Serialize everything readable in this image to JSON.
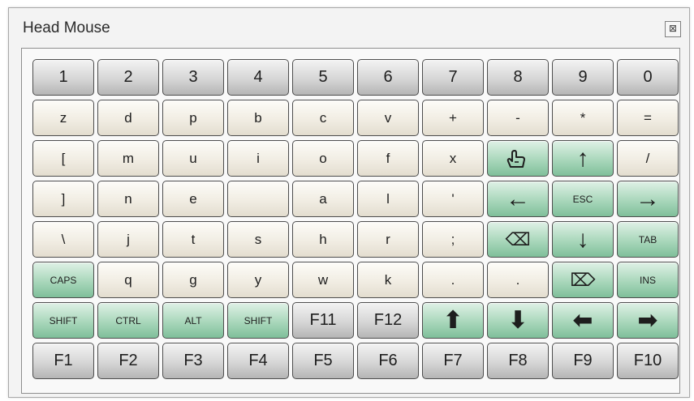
{
  "window": {
    "title": "Head Mouse",
    "close_glyph": "⊠"
  },
  "keyboard": {
    "rows": [
      [
        {
          "label": "1",
          "style": "gray"
        },
        {
          "label": "2",
          "style": "gray"
        },
        {
          "label": "3",
          "style": "gray"
        },
        {
          "label": "4",
          "style": "gray"
        },
        {
          "label": "5",
          "style": "gray"
        },
        {
          "label": "6",
          "style": "gray"
        },
        {
          "label": "7",
          "style": "gray"
        },
        {
          "label": "8",
          "style": "gray"
        },
        {
          "label": "9",
          "style": "gray"
        },
        {
          "label": "0",
          "style": "gray"
        }
      ],
      [
        {
          "label": "z",
          "style": "cream"
        },
        {
          "label": "d",
          "style": "cream"
        },
        {
          "label": "p",
          "style": "cream"
        },
        {
          "label": "b",
          "style": "cream"
        },
        {
          "label": "c",
          "style": "cream"
        },
        {
          "label": "v",
          "style": "cream"
        },
        {
          "label": "+",
          "style": "cream"
        },
        {
          "label": "-",
          "style": "cream"
        },
        {
          "label": "*",
          "style": "cream"
        },
        {
          "label": "=",
          "style": "cream"
        }
      ],
      [
        {
          "label": "[",
          "style": "cream"
        },
        {
          "label": "m",
          "style": "cream"
        },
        {
          "label": "u",
          "style": "cream"
        },
        {
          "label": "i",
          "style": "cream"
        },
        {
          "label": "o",
          "style": "cream"
        },
        {
          "label": "f",
          "style": "cream"
        },
        {
          "label": "x",
          "style": "cream"
        },
        {
          "label": "",
          "style": "green",
          "icon": "hand-pointer-icon"
        },
        {
          "label": "↑",
          "style": "green",
          "icon": "arrow-up-icon"
        },
        {
          "label": "/",
          "style": "cream"
        }
      ],
      [
        {
          "label": "]",
          "style": "cream"
        },
        {
          "label": "n",
          "style": "cream"
        },
        {
          "label": "e",
          "style": "cream"
        },
        {
          "label": "",
          "style": "cream"
        },
        {
          "label": "a",
          "style": "cream"
        },
        {
          "label": "l",
          "style": "cream"
        },
        {
          "label": "'",
          "style": "cream"
        },
        {
          "label": "←",
          "style": "green",
          "icon": "arrow-left-icon"
        },
        {
          "label": "ESC",
          "style": "green"
        },
        {
          "label": "→",
          "style": "green",
          "icon": "arrow-right-icon"
        }
      ],
      [
        {
          "label": "\\",
          "style": "cream"
        },
        {
          "label": "j",
          "style": "cream"
        },
        {
          "label": "t",
          "style": "cream"
        },
        {
          "label": "s",
          "style": "cream"
        },
        {
          "label": "h",
          "style": "cream"
        },
        {
          "label": "r",
          "style": "cream"
        },
        {
          "label": ";",
          "style": "cream"
        },
        {
          "label": "⌫",
          "style": "green",
          "icon": "backspace-icon"
        },
        {
          "label": "↓",
          "style": "green",
          "icon": "arrow-down-icon"
        },
        {
          "label": "TAB",
          "style": "green"
        }
      ],
      [
        {
          "label": "CAPS",
          "style": "green"
        },
        {
          "label": "q",
          "style": "cream"
        },
        {
          "label": "g",
          "style": "cream"
        },
        {
          "label": "y",
          "style": "cream"
        },
        {
          "label": "w",
          "style": "cream"
        },
        {
          "label": "k",
          "style": "cream"
        },
        {
          "label": ".",
          "style": "cream"
        },
        {
          "label": ".",
          "style": "cream"
        },
        {
          "label": "⌦",
          "style": "green",
          "icon": "delete-icon"
        },
        {
          "label": "INS",
          "style": "green"
        }
      ],
      [
        {
          "label": "SHIFT",
          "style": "green"
        },
        {
          "label": "CTRL",
          "style": "green"
        },
        {
          "label": "ALT",
          "style": "green"
        },
        {
          "label": "SHIFT",
          "style": "green"
        },
        {
          "label": "F11",
          "style": "gray"
        },
        {
          "label": "F12",
          "style": "gray"
        },
        {
          "label": "⬆",
          "style": "green",
          "icon": "bold-arrow-up-icon"
        },
        {
          "label": "⬇",
          "style": "green",
          "icon": "bold-arrow-down-icon"
        },
        {
          "label": "⬅",
          "style": "green",
          "icon": "bold-arrow-left-icon"
        },
        {
          "label": "➡",
          "style": "green",
          "icon": "bold-arrow-right-icon"
        }
      ],
      [
        {
          "label": "F1",
          "style": "gray"
        },
        {
          "label": "F2",
          "style": "gray"
        },
        {
          "label": "F3",
          "style": "gray"
        },
        {
          "label": "F4",
          "style": "gray"
        },
        {
          "label": "F5",
          "style": "gray"
        },
        {
          "label": "F6",
          "style": "gray"
        },
        {
          "label": "F7",
          "style": "gray"
        },
        {
          "label": "F8",
          "style": "gray"
        },
        {
          "label": "F9",
          "style": "gray"
        },
        {
          "label": "F10",
          "style": "gray"
        }
      ]
    ]
  }
}
